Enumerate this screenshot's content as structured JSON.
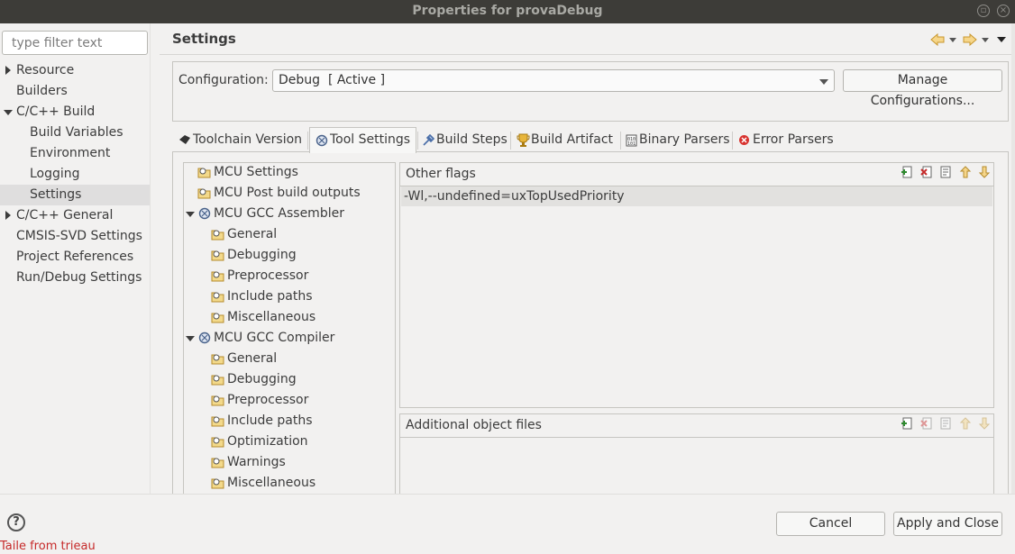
{
  "window": {
    "title": "Properties for provaDebug"
  },
  "filter": {
    "placeholder": "type filter text"
  },
  "nav": {
    "items": [
      {
        "label": "Resource"
      },
      {
        "label": "Builders"
      },
      {
        "label": "C/C++ Build"
      },
      {
        "label": "Build Variables"
      },
      {
        "label": "Environment"
      },
      {
        "label": "Logging"
      },
      {
        "label": "Settings"
      },
      {
        "label": "C/C++ General"
      },
      {
        "label": "CMSIS-SVD Settings"
      },
      {
        "label": "Project References"
      },
      {
        "label": "Run/Debug Settings"
      }
    ],
    "selected": "Settings"
  },
  "header": {
    "title": "Settings"
  },
  "configuration": {
    "label": "Configuration:",
    "value": "Debug  [ Active ]",
    "manage_label": "Manage Configurations..."
  },
  "tabs": [
    {
      "label": "Toolchain  Version"
    },
    {
      "label": "Tool Settings"
    },
    {
      "label": "Build Steps"
    },
    {
      "label": "Build Artifact"
    },
    {
      "label": "Binary Parsers"
    },
    {
      "label": "Error Parsers"
    }
  ],
  "active_tab": "Tool Settings",
  "tree": [
    {
      "label": "MCU Settings"
    },
    {
      "label": "MCU Post build outputs"
    },
    {
      "label": "MCU GCC Assembler"
    },
    {
      "label": "General"
    },
    {
      "label": "Debugging"
    },
    {
      "label": "Preprocessor"
    },
    {
      "label": "Include paths"
    },
    {
      "label": "Miscellaneous"
    },
    {
      "label": "MCU GCC Compiler"
    },
    {
      "label": "General"
    },
    {
      "label": "Debugging"
    },
    {
      "label": "Preprocessor"
    },
    {
      "label": "Include paths"
    },
    {
      "label": "Optimization"
    },
    {
      "label": "Warnings"
    },
    {
      "label": "Miscellaneous"
    }
  ],
  "other_flags": {
    "title": "Other flags",
    "items": [
      "-Wl,--undefined=uxTopUsedPriority"
    ]
  },
  "additional_objects": {
    "title": "Additional object files",
    "items": []
  },
  "buttons": {
    "cancel": "Cancel",
    "apply_close": "Apply and Close",
    "help": "?"
  },
  "background_strip": {
    "text": "Taile  from  trieau"
  }
}
